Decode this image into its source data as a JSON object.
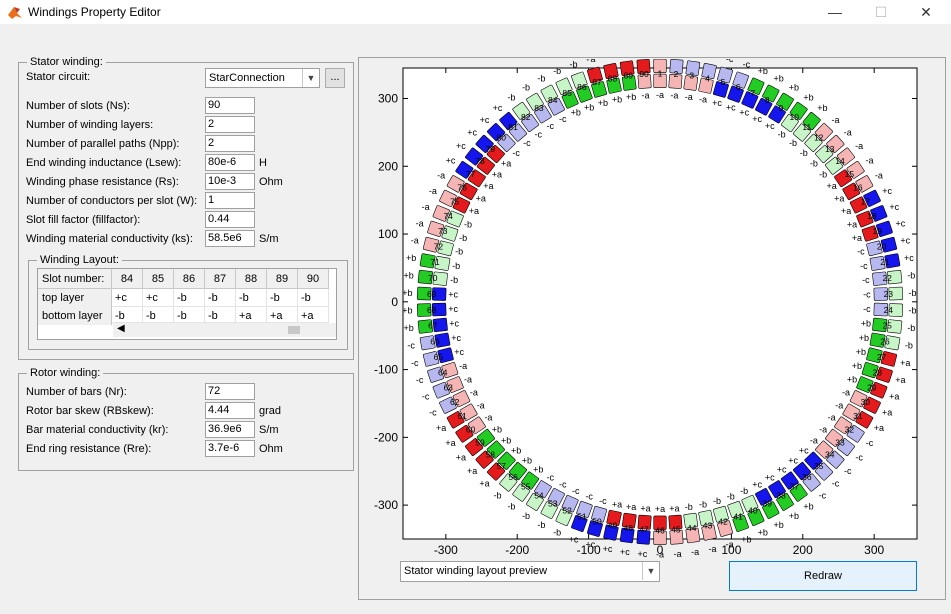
{
  "window": {
    "title": "Windings Property Editor",
    "minimize": "—",
    "maximize": "☐",
    "close": "✕"
  },
  "stator": {
    "legend": "Stator winding:",
    "circuit_label": "Stator circuit:",
    "circuit_value": "StarConnection",
    "browse_label": "...",
    "fields": [
      {
        "label": "Number of slots (Ns):",
        "value": "90",
        "unit": ""
      },
      {
        "label": "Number of winding layers:",
        "value": "2",
        "unit": ""
      },
      {
        "label": "Number of parallel paths (Npp):",
        "value": "2",
        "unit": ""
      },
      {
        "label": "End winding inductance (Lsew):",
        "value": "80e-6",
        "unit": "H"
      },
      {
        "label": "Winding phase resistance (Rs):",
        "value": "10e-3",
        "unit": "Ohm"
      },
      {
        "label": "Number of conductors per slot (W):",
        "value": "1",
        "unit": ""
      },
      {
        "label": "Slot fill factor (fillfactor):",
        "value": "0.44",
        "unit": ""
      },
      {
        "label": "Winding material conductivity (ks):",
        "value": "58.5e6",
        "unit": "S/m"
      }
    ]
  },
  "layout": {
    "legend": "Winding Layout:",
    "header_label": "Slot number:",
    "row_labels": [
      "top layer",
      "bottom layer"
    ],
    "columns": [
      "84",
      "85",
      "86",
      "87",
      "88",
      "89",
      "90"
    ],
    "top_layer": [
      "+c",
      "+c",
      "-b",
      "-b",
      "-b",
      "-b",
      "-b"
    ],
    "bottom_layer": [
      "-b",
      "-b",
      "-b",
      "-b",
      "+a",
      "+a",
      "+a"
    ]
  },
  "rotor": {
    "legend": "Rotor winding:",
    "fields": [
      {
        "label": "Number of bars (Nr):",
        "value": "72",
        "unit": ""
      },
      {
        "label": "Rotor bar skew (RBskew):",
        "value": "4.44",
        "unit": "grad"
      },
      {
        "label": "Bar material conductivity (kr):",
        "value": "36.9e6",
        "unit": "S/m"
      },
      {
        "label": "End ring resistance (Rre):",
        "value": "3.7e-6",
        "unit": "Ohm"
      }
    ]
  },
  "preview": {
    "select_value": "Stator winding layout preview",
    "redraw_label": "Redraw"
  },
  "chart_data": {
    "type": "scatter",
    "title": "",
    "xlabel": "",
    "ylabel": "",
    "xlim": [
      -360,
      360
    ],
    "ylim": [
      -350,
      345
    ],
    "xticks": [
      -300,
      -200,
      -100,
      0,
      100,
      200,
      300
    ],
    "yticks": [
      300,
      200,
      100,
      0,
      -100,
      -200,
      -300
    ],
    "grid": false,
    "slot_count": 90,
    "slot_first_angle_deg": 90,
    "slot_step_deg": -4,
    "inner_radius": 300,
    "outer_radius": 340,
    "top_layer": [
      "-a",
      "-a",
      "-a",
      "-a",
      "+c",
      "+c",
      "+c",
      "+c",
      "+c",
      "-b",
      "-b",
      "-b",
      "-b",
      "-b",
      "+a",
      "+a",
      "+a",
      "+a",
      "+a",
      "-c",
      "-c",
      "-c",
      "-c",
      "-c",
      "+b",
      "+b",
      "+b",
      "+b",
      "+b",
      "-a",
      "-a",
      "-a",
      "-a",
      "-a",
      "+c",
      "+c",
      "+c",
      "+c",
      "+c",
      "-b",
      "-b",
      "-b",
      "-b",
      "-b",
      "+a",
      "+a",
      "+a",
      "+a",
      "+a",
      "-c",
      "-c",
      "-c",
      "-c",
      "-c",
      "+b",
      "+b",
      "+b",
      "+b",
      "+b",
      "-a",
      "-a",
      "-a",
      "-a",
      "-a",
      "+c",
      "+c",
      "+c",
      "+c",
      "+c",
      "-b",
      "-b",
      "-b",
      "-b",
      "-b",
      "+a",
      "+a",
      "+a",
      "+a",
      "+a",
      "-c",
      "-c",
      "-c",
      "-c",
      "-c",
      "+b",
      "+b",
      "+b",
      "+b",
      "+b",
      "-a"
    ],
    "bottom_layer": [
      "-a",
      "-c",
      "-c",
      "-c",
      "-c",
      "-c",
      "+b",
      "+b",
      "+b",
      "+b",
      "+b",
      "-a",
      "-a",
      "-a",
      "-a",
      "-a",
      "+c",
      "+c",
      "+c",
      "+c",
      "+c",
      "-b",
      "-b",
      "-b",
      "-b",
      "-b",
      "+a",
      "+a",
      "+a",
      "+a",
      "+a",
      "-c",
      "-c",
      "-c",
      "-c",
      "-c",
      "+b",
      "+b",
      "+b",
      "+b",
      "+b",
      "-a",
      "-a",
      "-a",
      "-a",
      "-a",
      "+c",
      "+c",
      "+c",
      "+c",
      "+c",
      "-b",
      "-b",
      "-b",
      "-b",
      "-b",
      "+a",
      "+a",
      "+a",
      "+a",
      "+a",
      "-c",
      "-c",
      "-c",
      "-c",
      "-c",
      "+b",
      "+b",
      "+b",
      "+b",
      "+b",
      "-a",
      "-a",
      "-a",
      "-a",
      "-a",
      "+c",
      "+c",
      "+c",
      "+c",
      "+c",
      "-b",
      "-b",
      "-b",
      "-b",
      "-b",
      "+a",
      "+a",
      "+a",
      "+a"
    ],
    "phase_colors": {
      "+a": "#e41a1c",
      "-a": "#f5b5b5",
      "+b": "#22cc22",
      "-b": "#c8f5c8",
      "+c": "#1515ee",
      "-c": "#b8b8f0"
    }
  }
}
